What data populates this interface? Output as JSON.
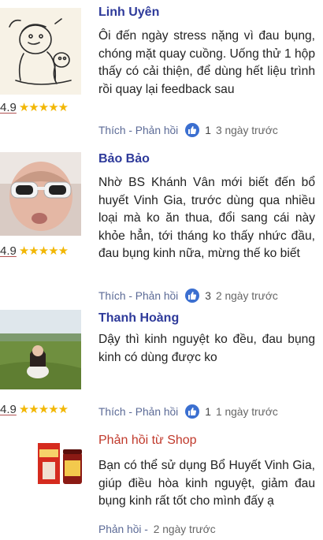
{
  "colors": {
    "name": "#2e3a9a",
    "shop": "#c0392b",
    "star": "#f2b705",
    "like_badge": "#3b6fd0",
    "action": "#5b6a96"
  },
  "reviews": [
    {
      "name": "Linh Uyên",
      "rating": "4.9",
      "stars": "★★★★★",
      "text": "Ôi đến ngày stress nặng vì đau bụng, chóng mặt quay cuồng. Uống thử 1 hộp thấy có cải thiện, để dùng hết liệu trình rồi quay lại feedback sau",
      "like_label": "Thích",
      "separator": " - ",
      "reply_label": "Phản hồi",
      "likes": "1",
      "time": "3 ngày trước"
    },
    {
      "name": "Bảo Bảo",
      "rating": "4.9",
      "stars": "★★★★★",
      "text": "Nhờ BS Khánh Vân mới biết đến bổ huyết Vinh Gia, trước dùng qua nhiều loại mà ko ăn thua, đổi sang cái này khỏe hẳn, tới tháng ko thấy nhức đầu, đau bụng kinh nữa, mừng thế ko biết",
      "like_label": "Thích",
      "separator": " - ",
      "reply_label": "Phản hồi",
      "likes": "3",
      "time": "2 ngày trước"
    },
    {
      "name": "Thanh Hoàng",
      "rating": "4.9",
      "stars": "★★★★★",
      "text": "Dậy thì kinh nguyệt ko đều, đau bụng kinh có dùng được ko",
      "like_label": "Thích",
      "separator": " - ",
      "reply_label": "Phản hồi",
      "likes": "1",
      "time": "1 ngày trước"
    }
  ],
  "shop_reply": {
    "title": "Phản hồi từ Shop",
    "text": "Bạn có thể sử dụng Bổ Huyết Vinh Gia, giúp điều hòa kinh nguyệt, giảm đau bụng kinh rất tốt cho mình đấy ạ",
    "reply_label": "Phản hồi",
    "separator": " - ",
    "time": "2 ngày trước"
  }
}
